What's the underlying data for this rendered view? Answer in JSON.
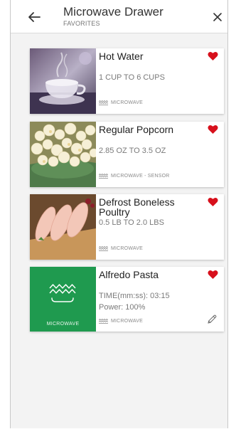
{
  "header": {
    "title": "Microwave Drawer",
    "subtitle": "FAVORITES"
  },
  "cards": [
    {
      "name": "Hot Water",
      "detail": "1 CUP TO 6 CUPS",
      "mode": "MICROWAVE",
      "favorite": true
    },
    {
      "name": "Regular Popcorn",
      "detail": "2.85 OZ TO 3.5 OZ",
      "mode": "MICROWAVE - SENSOR",
      "favorite": true
    },
    {
      "name": "Defrost Boneless Poultry",
      "detail": "0.5 LB TO 2.0 LBS",
      "mode": "MICROWAVE",
      "favorite": true
    },
    {
      "name": "Alfredo Pasta",
      "detail_time": "TIME(mm:ss): 03:15",
      "detail_power": "Power: 100%",
      "mode": "MICROWAVE",
      "tile_label": "MICROWAVE",
      "favorite": true,
      "editable": true
    }
  ],
  "colors": {
    "accent_green": "#1f9a4f",
    "heart_red": "#d7101c"
  }
}
